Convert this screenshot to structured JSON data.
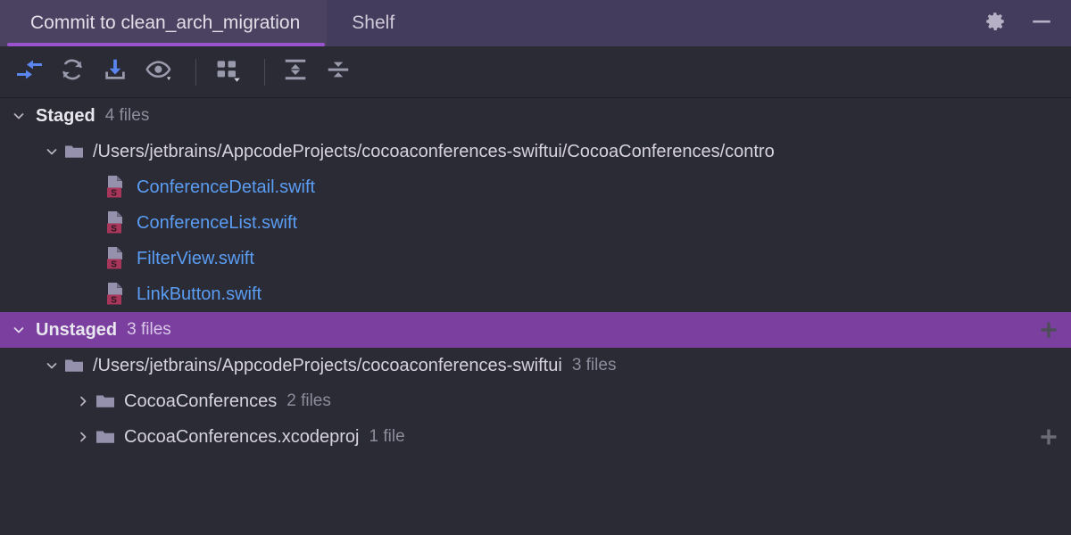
{
  "window": {
    "tabs": [
      {
        "label": "Commit to clean_arch_migration",
        "active": true
      },
      {
        "label": "Shelf",
        "active": false
      }
    ],
    "actions": [
      {
        "name": "settings-button",
        "icon": "gear-icon"
      },
      {
        "name": "minimize-button",
        "icon": "minus-icon"
      }
    ],
    "accent_color": "#9b52cd",
    "header_bg": "#443c5c",
    "selection_color": "#7b3fa0"
  },
  "toolbar": {
    "buttons": [
      {
        "name": "show-diff-button",
        "icon": "diff-arrows-icon",
        "color": "#5a86f0"
      },
      {
        "name": "refresh-button",
        "icon": "refresh-icon",
        "color": "#9a9aad"
      },
      {
        "name": "update-project-button",
        "icon": "download-icon",
        "color": "#5a86f0"
      },
      {
        "name": "preview-diff-button",
        "icon": "eye-dropdown-icon",
        "color": "#9a9aad"
      },
      {
        "name": "group-by-button",
        "icon": "group-by-dropdown-icon",
        "color": "#9a9aad"
      },
      {
        "name": "expand-all-button",
        "icon": "expand-all-icon",
        "color": "#9a9aad"
      },
      {
        "name": "collapse-all-button",
        "icon": "collapse-all-icon",
        "color": "#9a9aad"
      }
    ]
  },
  "tree": {
    "staged": {
      "title": "Staged",
      "count": "4 files",
      "expanded": true,
      "folder": {
        "path": "/Users/jetbrains/AppcodeProjects/cocoaconferences-swiftui/CocoaConferences/contro",
        "expanded": true
      },
      "files": [
        {
          "name": "ConferenceDetail.swift",
          "icon": "swift-file-icon"
        },
        {
          "name": "ConferenceList.swift",
          "icon": "swift-file-icon"
        },
        {
          "name": "FilterView.swift",
          "icon": "swift-file-icon"
        },
        {
          "name": "LinkButton.swift",
          "icon": "swift-file-icon"
        }
      ]
    },
    "unstaged": {
      "title": "Unstaged",
      "count": "3 files",
      "expanded": true,
      "selected": true,
      "add_icon": "plus-icon",
      "folder": {
        "path": "/Users/jetbrains/AppcodeProjects/cocoaconferences-swiftui",
        "count": "3 files",
        "expanded": true
      },
      "children": [
        {
          "name": "CocoaConferences",
          "count": "2 files",
          "expanded": false,
          "has_add": false
        },
        {
          "name": "CocoaConferences.xcodeproj",
          "count": "1 file",
          "expanded": false,
          "has_add": true,
          "add_icon": "plus-icon"
        }
      ]
    }
  }
}
